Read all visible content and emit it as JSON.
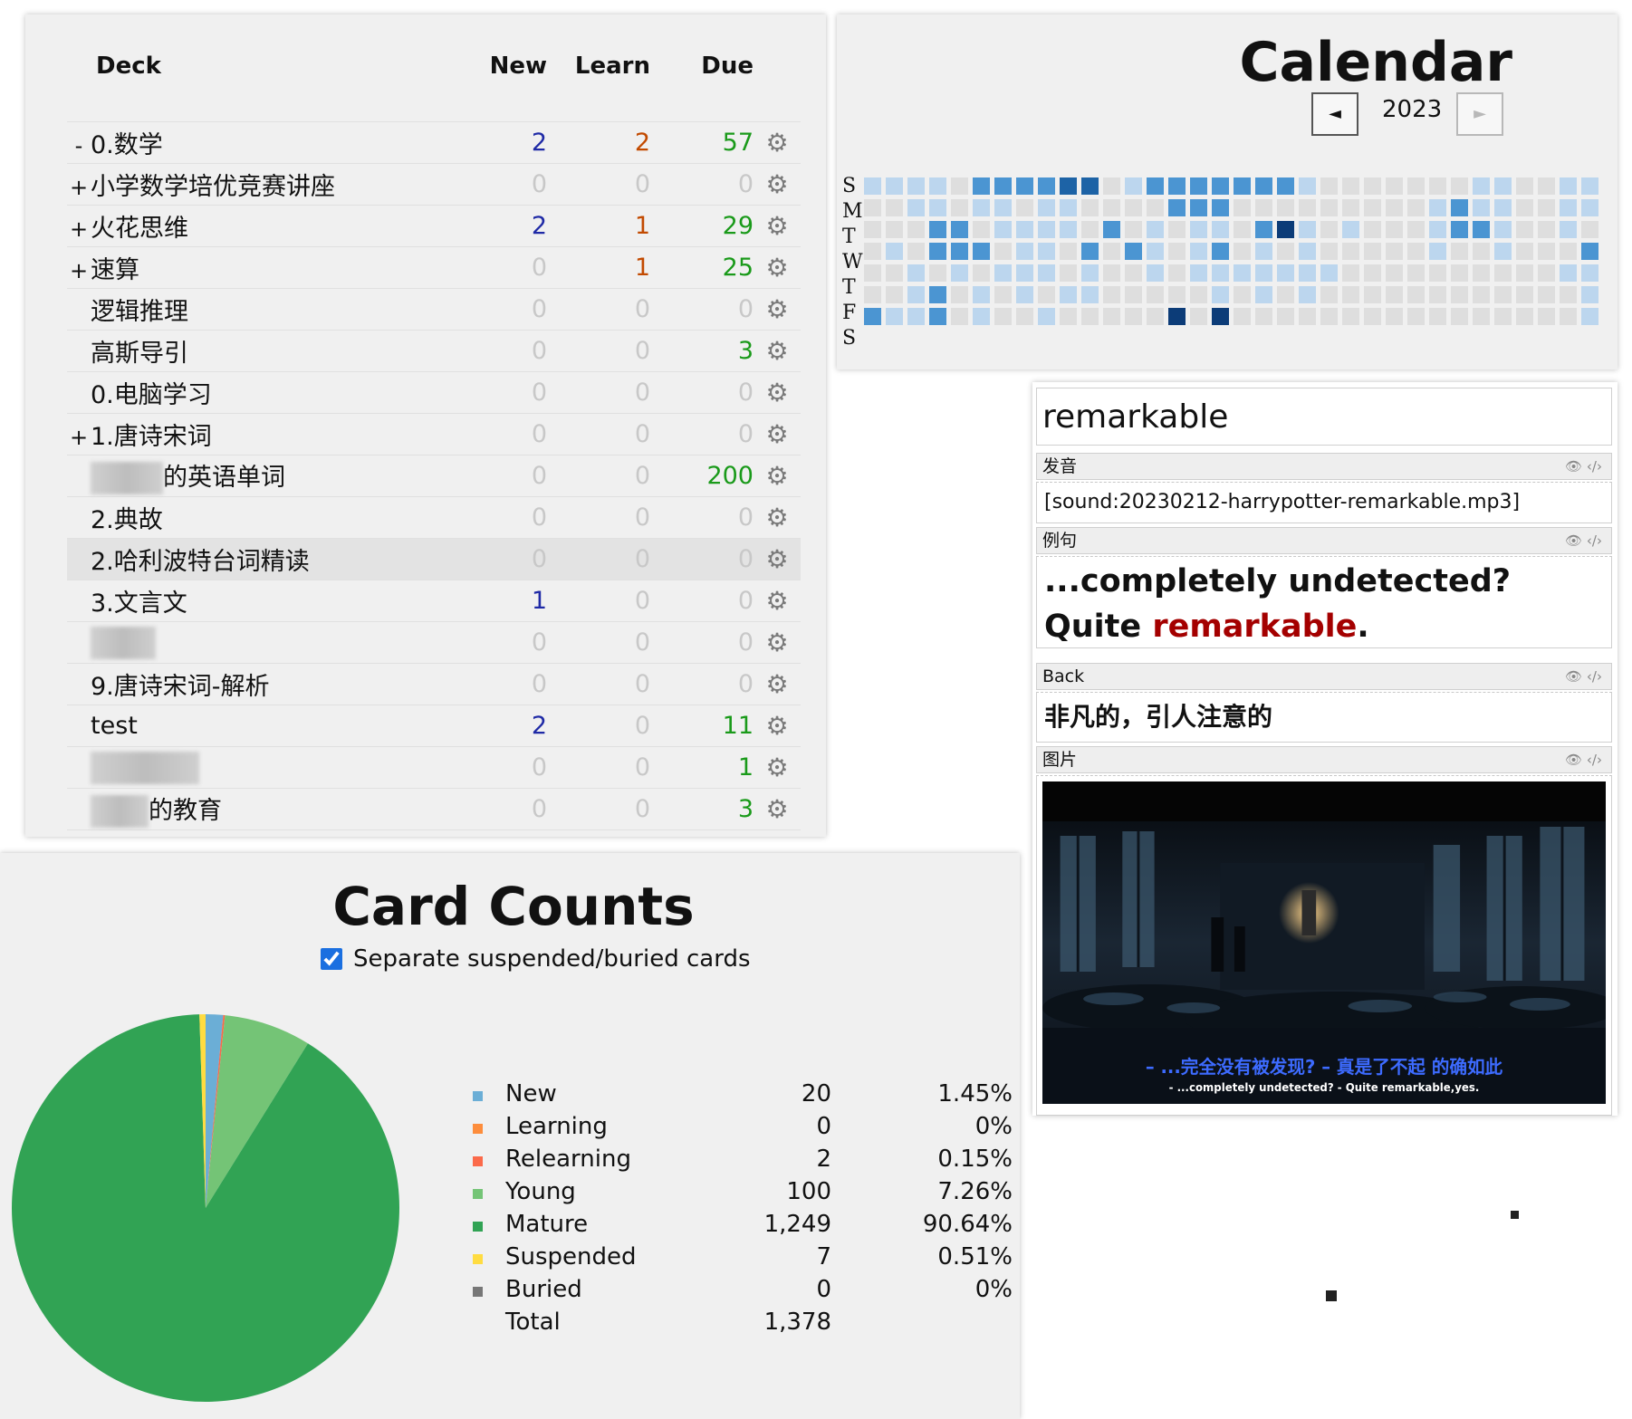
{
  "deck_list": {
    "headers": {
      "deck": "Deck",
      "new": "New",
      "learn": "Learn",
      "due": "Due"
    },
    "rows": [
      {
        "expander": "-",
        "name": "0.数学",
        "new": "2",
        "learn": "2",
        "due": "57"
      },
      {
        "expander": "+",
        "name": "小学数学培优竞赛讲座",
        "new": "0",
        "learn": "0",
        "due": "0"
      },
      {
        "expander": "+",
        "name": "火花思维",
        "new": "2",
        "learn": "1",
        "due": "29"
      },
      {
        "expander": "+",
        "name": "速算",
        "new": "0",
        "learn": "1",
        "due": "25"
      },
      {
        "expander": "",
        "name": "逻辑推理",
        "new": "0",
        "learn": "0",
        "due": "0"
      },
      {
        "expander": "",
        "name": "高斯导引",
        "new": "0",
        "learn": "0",
        "due": "3"
      },
      {
        "expander": "",
        "name": "0.电脑学习",
        "new": "0",
        "learn": "0",
        "due": "0"
      },
      {
        "expander": "+",
        "name": "1.唐诗宋词",
        "new": "0",
        "learn": "0",
        "due": "0"
      },
      {
        "expander": "",
        "name": "的英语单词",
        "new": "0",
        "learn": "0",
        "due": "200"
      },
      {
        "expander": "",
        "name": "2.典故",
        "new": "0",
        "learn": "0",
        "due": "0"
      },
      {
        "expander": "",
        "name": "2.哈利波特台词精读",
        "new": "0",
        "learn": "0",
        "due": "0"
      },
      {
        "expander": "",
        "name": "3.文言文",
        "new": "1",
        "learn": "0",
        "due": "0"
      },
      {
        "expander": "",
        "name": "",
        "new": "0",
        "learn": "0",
        "due": "0"
      },
      {
        "expander": "",
        "name": "9.唐诗宋词-解析",
        "new": "0",
        "learn": "0",
        "due": "0"
      },
      {
        "expander": "",
        "name": "test",
        "new": "2",
        "learn": "0",
        "due": "11"
      },
      {
        "expander": "",
        "name": "",
        "new": "0",
        "learn": "0",
        "due": "1"
      },
      {
        "expander": "",
        "name": "的教育",
        "new": "0",
        "learn": "0",
        "due": "3"
      }
    ]
  },
  "calendar": {
    "title": "Calendar",
    "year": "2023",
    "prev_icon": "◄",
    "next_icon": "►",
    "day_labels": [
      "S",
      "M",
      "T",
      "W",
      "T",
      "F",
      "S"
    ],
    "weeks": 34,
    "activity_rows": [
      "1111022223301222222210000000110011000000",
      "0011011011000022200000000012110011000200",
      "0002201111020101102410100012210010000000",
      "0102220110202101201010000010010002000000",
      "0010101110100101111111000000000011000000",
      "0012010101100000101010000000000001200000",
      "2112010010000040400000000000000001000000"
    ],
    "colors": {
      "empty": "#dedede",
      "level1": "#bcd6ee",
      "level2": "#4b95d2",
      "level3": "#1d63a6",
      "level4": "#0c3c78"
    }
  },
  "card_editor": {
    "front_word": "remarkable",
    "fields": [
      {
        "name": "发音",
        "value": "[sound:20230212-harrypotter-remarkable.mp3]"
      },
      {
        "name": "例句",
        "value_pre": "...completely undetected? Quite ",
        "value_kw": "remarkable",
        "value_post": "."
      },
      {
        "name": "Back",
        "value": "非凡的，引人注意的"
      },
      {
        "name": "图片",
        "subtitle_cn": "– ...完全没有被发现? – 真是了不起  的确如此",
        "subtitle_en": "- ...completely undetected? - Quite remarkable,yes."
      }
    ],
    "field_controls": "👁 ‹/›"
  },
  "card_counts": {
    "title": "Card Counts",
    "checkbox_label": "Separate suspended/buried cards",
    "checkbox_checked": true,
    "legend": [
      {
        "label": "New",
        "count": "20",
        "percent": "1.45%",
        "color": "#6baed6"
      },
      {
        "label": "Learning",
        "count": "0",
        "percent": "0%",
        "color": "#fd8d3c"
      },
      {
        "label": "Relearning",
        "count": "2",
        "percent": "0.15%",
        "color": "#fb6a4a"
      },
      {
        "label": "Young",
        "count": "100",
        "percent": "7.26%",
        "color": "#74c476"
      },
      {
        "label": "Mature",
        "count": "1,249",
        "percent": "90.64%",
        "color": "#31a354"
      },
      {
        "label": "Suspended",
        "count": "7",
        "percent": "0.51%",
        "color": "#ffdc41"
      },
      {
        "label": "Buried",
        "count": "0",
        "percent": "0%",
        "color": "#777777"
      }
    ],
    "total_label": "Total",
    "total_count": "1,378"
  },
  "chart_data": {
    "type": "pie",
    "categories": [
      "New",
      "Learning",
      "Relearning",
      "Young",
      "Mature",
      "Suspended",
      "Buried"
    ],
    "values": [
      20,
      0,
      2,
      100,
      1249,
      7,
      0
    ],
    "colors": [
      "#6baed6",
      "#fd8d3c",
      "#fb6a4a",
      "#74c476",
      "#31a354",
      "#ffdc41",
      "#777777"
    ],
    "title": "Card Counts",
    "legend": "right"
  }
}
